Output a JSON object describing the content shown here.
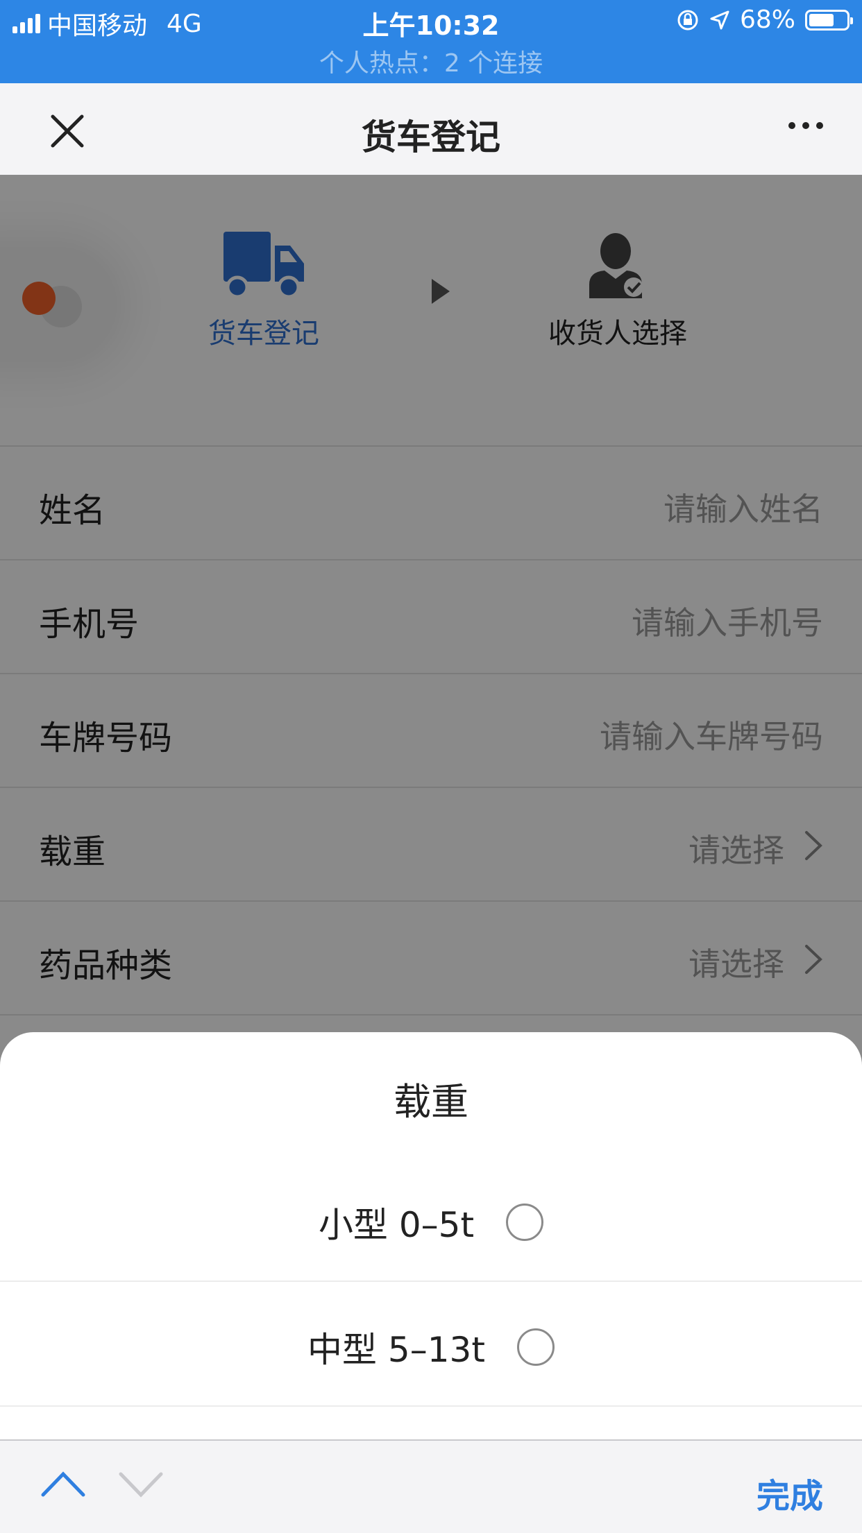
{
  "status_bar": {
    "carrier": "中国移动",
    "network": "4G",
    "time": "上午10:32",
    "battery": "68%",
    "battery_level": 0.68,
    "hotspot": "个人热点：2 个连接"
  },
  "nav": {
    "title": "货车登记",
    "close_icon": "close-icon",
    "more_icon": "more-icon"
  },
  "steps": [
    {
      "label": "货车登记",
      "icon": "truck-icon",
      "active": true
    },
    {
      "label": "收货人选择",
      "icon": "person-check-icon",
      "active": false
    }
  ],
  "form": {
    "rows": [
      {
        "label": "姓名",
        "placeholder": "请输入姓名"
      },
      {
        "label": "手机号",
        "placeholder": "请输入手机号"
      },
      {
        "label": "车牌号码",
        "placeholder": "请输入车牌号码"
      },
      {
        "label": "载重",
        "value": "请选择"
      },
      {
        "label": "药品种类",
        "value": "请选择"
      }
    ]
  },
  "sheet": {
    "title": "载重",
    "options": [
      {
        "label": "小型 0–5t",
        "selected": false
      },
      {
        "label": "中型 5–13t",
        "selected": false
      }
    ]
  },
  "accessory": {
    "done": "完成"
  },
  "colors": {
    "status_bar": "#2d86e5",
    "accent": "#2f6fd0",
    "done": "#2f7fe0"
  }
}
